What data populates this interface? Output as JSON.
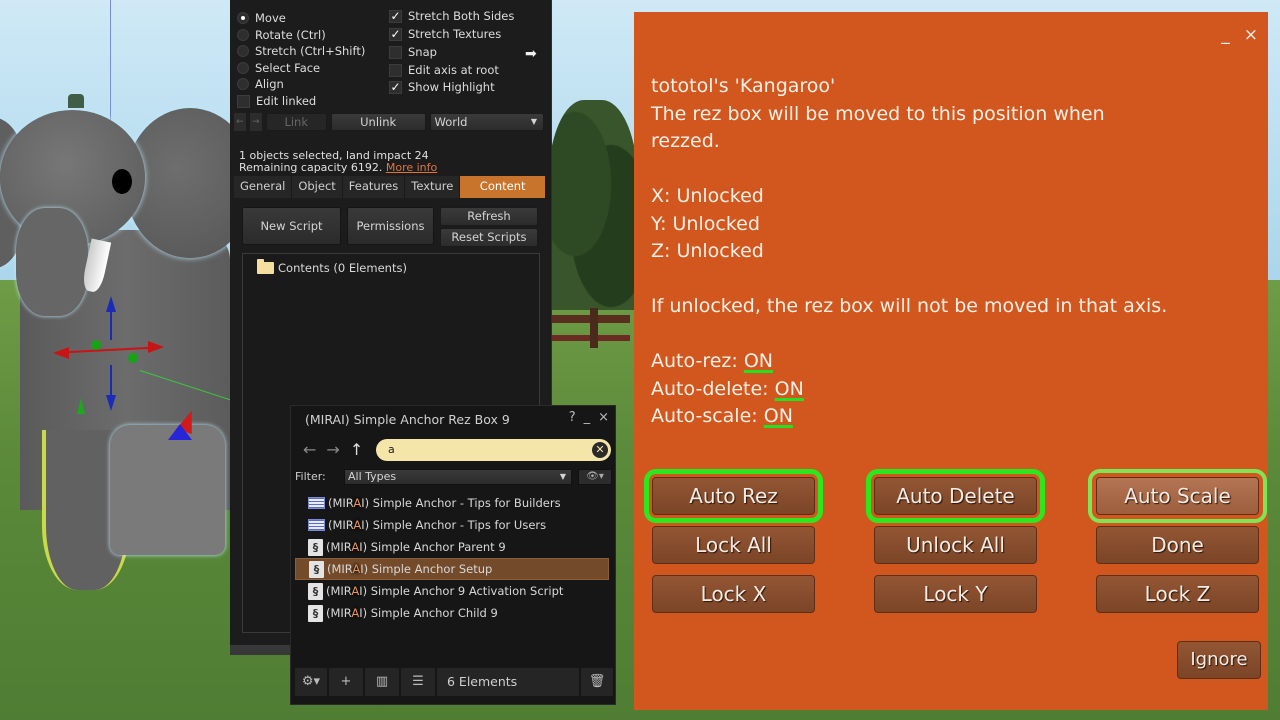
{
  "build_tools": {
    "modes": [
      {
        "label": "Move",
        "selected": true
      },
      {
        "label": "Rotate (Ctrl)",
        "selected": false
      },
      {
        "label": "Stretch (Ctrl+Shift)",
        "selected": false
      },
      {
        "label": "Select Face",
        "selected": false
      },
      {
        "label": "Align",
        "selected": false
      }
    ],
    "edit_linked": {
      "label": "Edit linked",
      "checked": false
    },
    "options": [
      {
        "label": "Stretch Both Sides",
        "checked": true
      },
      {
        "label": "Stretch Textures",
        "checked": true
      },
      {
        "label": "Snap",
        "checked": false
      },
      {
        "label": "Edit axis at root",
        "checked": false
      },
      {
        "label": "Show Highlight",
        "checked": true
      }
    ],
    "link_label": "Link",
    "unlink_label": "Unlink",
    "ruler_select": "World",
    "selection_info": "1 objects selected, land impact 24",
    "capacity_info": "Remaining capacity 6192.",
    "more_info_link": "More info",
    "tabs": [
      "General",
      "Object",
      "Features",
      "Texture",
      "Content"
    ],
    "active_tab": "Content",
    "new_script_label": "New Script",
    "permissions_label": "Permissions",
    "refresh_label": "Refresh",
    "reset_scripts_label": "Reset Scripts",
    "contents_label": "Contents (0 Elements)"
  },
  "inventory": {
    "title": "(MIRAI) Simple Anchor Rez Box 9",
    "help_label": "?",
    "minimize_label": "_",
    "close_label": "×",
    "search_value": "a",
    "filter_label": "Filter:",
    "filter_value": "All Types",
    "items": [
      {
        "prefix": "(MIR",
        "match": "A",
        "suffix": "I) Simple Anchor - Tips for Builders",
        "type": "notecard",
        "selected": false
      },
      {
        "prefix": "(MIR",
        "match": "A",
        "suffix": "I) Simple Anchor - Tips for Users",
        "type": "notecard",
        "selected": false
      },
      {
        "prefix": "(MIR",
        "match": "A",
        "suffix": "I) Simple Anchor Parent 9",
        "type": "script",
        "selected": false
      },
      {
        "prefix": "(MIR",
        "match": "A",
        "suffix": "I) Simple Anchor Setup",
        "type": "script",
        "selected": true
      },
      {
        "prefix": "(MIR",
        "match": "A",
        "suffix": "I) Simple Anchor 9 Activation Script",
        "type": "script",
        "selected": false
      },
      {
        "prefix": "(MIR",
        "match": "A",
        "suffix": "I) Simple Anchor Child 9",
        "type": "script",
        "selected": false
      }
    ],
    "element_count": "6 Elements"
  },
  "dialog": {
    "minimize_label": "_",
    "close_label": "×",
    "owner_line": "tototol's 'Kangaroo'",
    "desc_line1": "The rez box will be moved to this position when",
    "desc_line2": "rezzed.",
    "x_status": "X: Unlocked",
    "y_status": "Y: Unlocked",
    "z_status": "Z: Unlocked",
    "axis_note": "If unlocked, the rez box will not be moved in that axis.",
    "auto_rez_label": "Auto-rez:",
    "auto_rez_value": "ON",
    "auto_delete_label": "Auto-delete:",
    "auto_delete_value": "ON",
    "auto_scale_label": "Auto-scale:",
    "auto_scale_value": "ON",
    "buttons": [
      "Auto Rez",
      "Auto Delete",
      "Auto Scale",
      "Lock All",
      "Unlock All",
      "Done",
      "Lock X",
      "Lock Y",
      "Lock Z"
    ],
    "ignore_label": "Ignore",
    "colors": {
      "background": "#d2571f",
      "highlight": "#2ee61e"
    }
  }
}
